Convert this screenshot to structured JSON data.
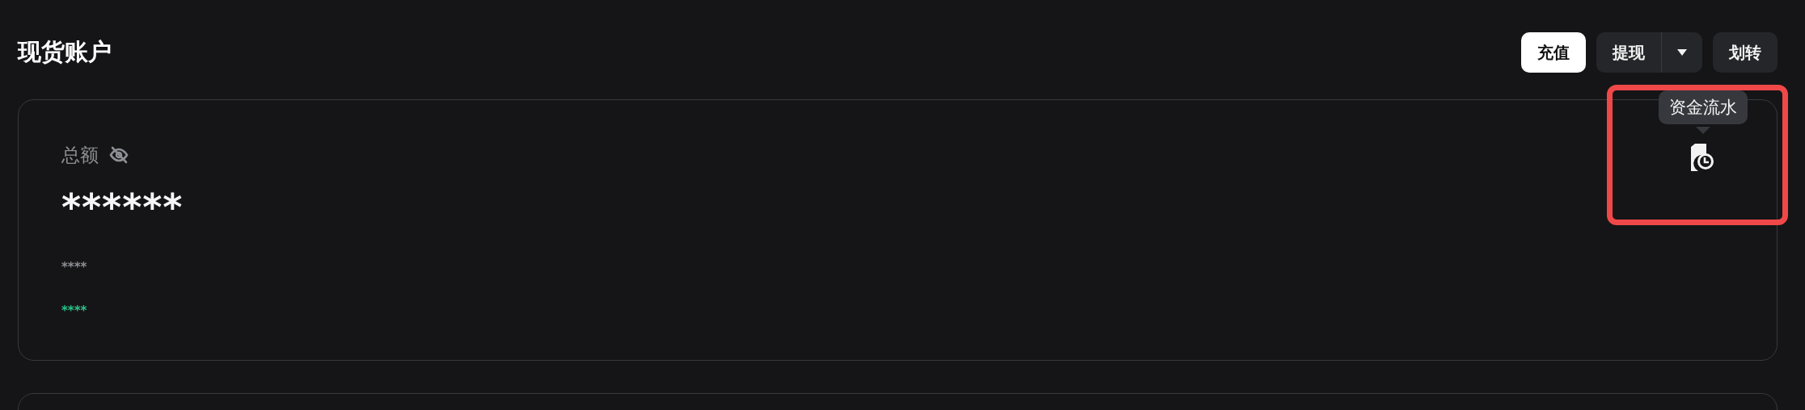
{
  "title": "现货账户",
  "actions": [
    {
      "label": "充值",
      "kind": "primary"
    },
    {
      "label": "提现",
      "kind": "split"
    },
    {
      "label": "划转",
      "kind": "secondary"
    }
  ],
  "balance": {
    "label": "总额",
    "hidden": true,
    "total": "******",
    "sub_value": "****",
    "pnl": "****"
  },
  "history": {
    "tooltip": "资金流水",
    "highlighted": true
  }
}
